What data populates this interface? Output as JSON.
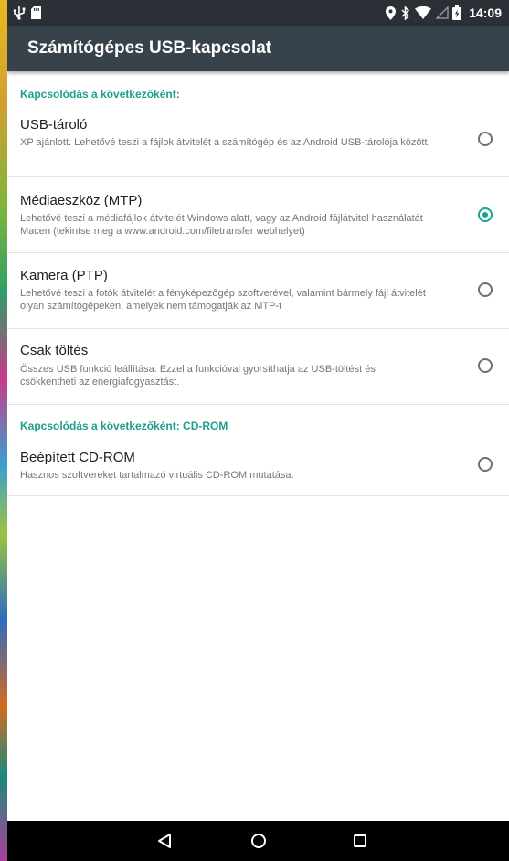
{
  "status_bar": {
    "time": "14:09",
    "left_icons": [
      "usb-icon",
      "sd-card-icon"
    ],
    "right_icons": [
      "location-icon",
      "bluetooth-icon",
      "wifi-icon",
      "signal-icon",
      "battery-icon"
    ]
  },
  "app_bar": {
    "title": "Számítógépes USB-kapcsolat"
  },
  "sections": [
    {
      "header": "Kapcsolódás a következőként:"
    },
    {
      "header": "Kapcsolódás a következőként: CD-ROM"
    }
  ],
  "options": [
    {
      "title": "USB-tároló",
      "summary": "XP ajánlott. Lehetővé teszi a fájlok átvitelét a számítógép és az Android USB-tárolója között.",
      "checked": false
    },
    {
      "title": "Médiaeszköz (MTP)",
      "summary": "Lehetővé teszi a médiafájlok átvitelét Windows alatt, vagy az Android fájlátvitel használatát Macen (tekintse meg a www.android.com/filetransfer webhelyet)",
      "checked": true
    },
    {
      "title": "Kamera (PTP)",
      "summary": "Lehetővé teszi a fotók átvitelét a fényképezőgép szoftverével, valamint bármely fájl átvitelét olyan számítógépeken, amelyek nem támogatják az MTP-t",
      "checked": false
    },
    {
      "title": "Csak töltés",
      "summary": "Összes USB funkció leállítása. Ezzel a funkcióval gyorsíthatja az USB-töltést és csökkentheti az energiafogyasztást.",
      "checked": false
    },
    {
      "title": "Beépített CD-ROM",
      "summary": "Hasznos szoftvereket tartalmazó virtuális CD-ROM mutatása.",
      "checked": false
    }
  ],
  "nav_bar": {
    "buttons": [
      "back-icon",
      "home-icon",
      "recents-icon"
    ]
  },
  "colors": {
    "accent": "#17a293",
    "app_bar": "#37424a",
    "status_bar": "#2a3036"
  }
}
